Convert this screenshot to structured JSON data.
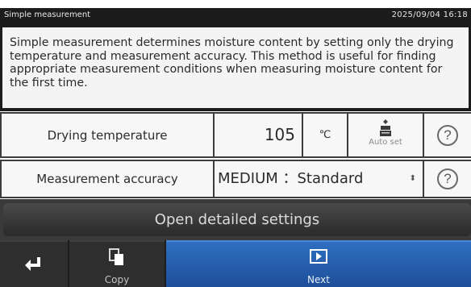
{
  "status_bar": {
    "title": "Simple measurement",
    "datetime": "2025/09/04 16:18"
  },
  "description": "Simple measurement determines moisture content by setting only the drying temperature and measurement accuracy. This method is useful for finding appropriate measurement conditions when measuring moisture content for the first time.",
  "drying_temperature": {
    "label": "Drying temperature",
    "value": "105",
    "unit": "℃",
    "auto_set_label": "Auto set",
    "help_symbol": "?"
  },
  "measurement_accuracy": {
    "label": "Measurement accuracy",
    "selected": "MEDIUM ：Standard",
    "arrow_symbol": "⬍",
    "help_symbol": "?"
  },
  "detailed_settings_button": "Open detailed settings",
  "bottom_bar": {
    "back_icon": "return-arrow-icon",
    "copy_label": "Copy",
    "next_label": "Next"
  },
  "colors": {
    "next_button": "#2661b0",
    "panel_background": "#f4f4f4",
    "frame": "#1c1c1c"
  }
}
